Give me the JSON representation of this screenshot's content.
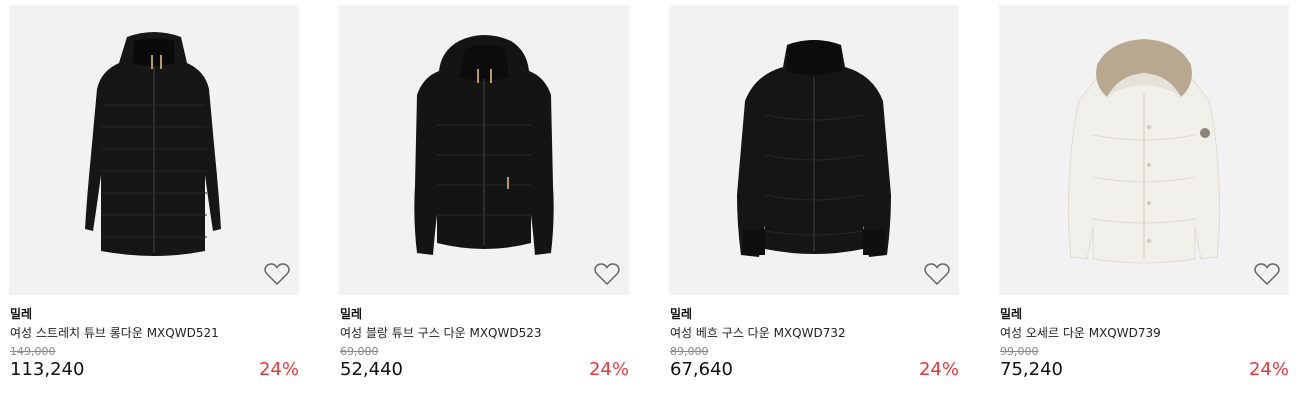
{
  "products": [
    {
      "brand": "밀레",
      "name": "여성 스트레치 튜브 롱다운 MXQWD521",
      "original_price": "149,000",
      "price": "113,240",
      "discount": "24%",
      "color": "#161616",
      "style": "long-down-coat",
      "icon": "heart-outline-icon"
    },
    {
      "brand": "밀레",
      "name": "여성 블랑 튜브 구스 다운 MXQWD523",
      "original_price": "69,000",
      "price": "52,440",
      "discount": "24%",
      "color": "#141414",
      "style": "short-hooded-down",
      "icon": "heart-outline-icon"
    },
    {
      "brand": "밀레",
      "name": "여성 베흐 구스 다운 MXQWD732",
      "original_price": "89,000",
      "price": "67,640",
      "discount": "24%",
      "color": "#151515",
      "style": "puffer-down",
      "icon": "heart-outline-icon"
    },
    {
      "brand": "밀레",
      "name": "여성 오세르 다운 MXQWD739",
      "original_price": "99,000",
      "price": "75,240",
      "discount": "24%",
      "color": "#f1efe9",
      "style": "fur-hood-down",
      "icon": "heart-outline-icon"
    }
  ]
}
